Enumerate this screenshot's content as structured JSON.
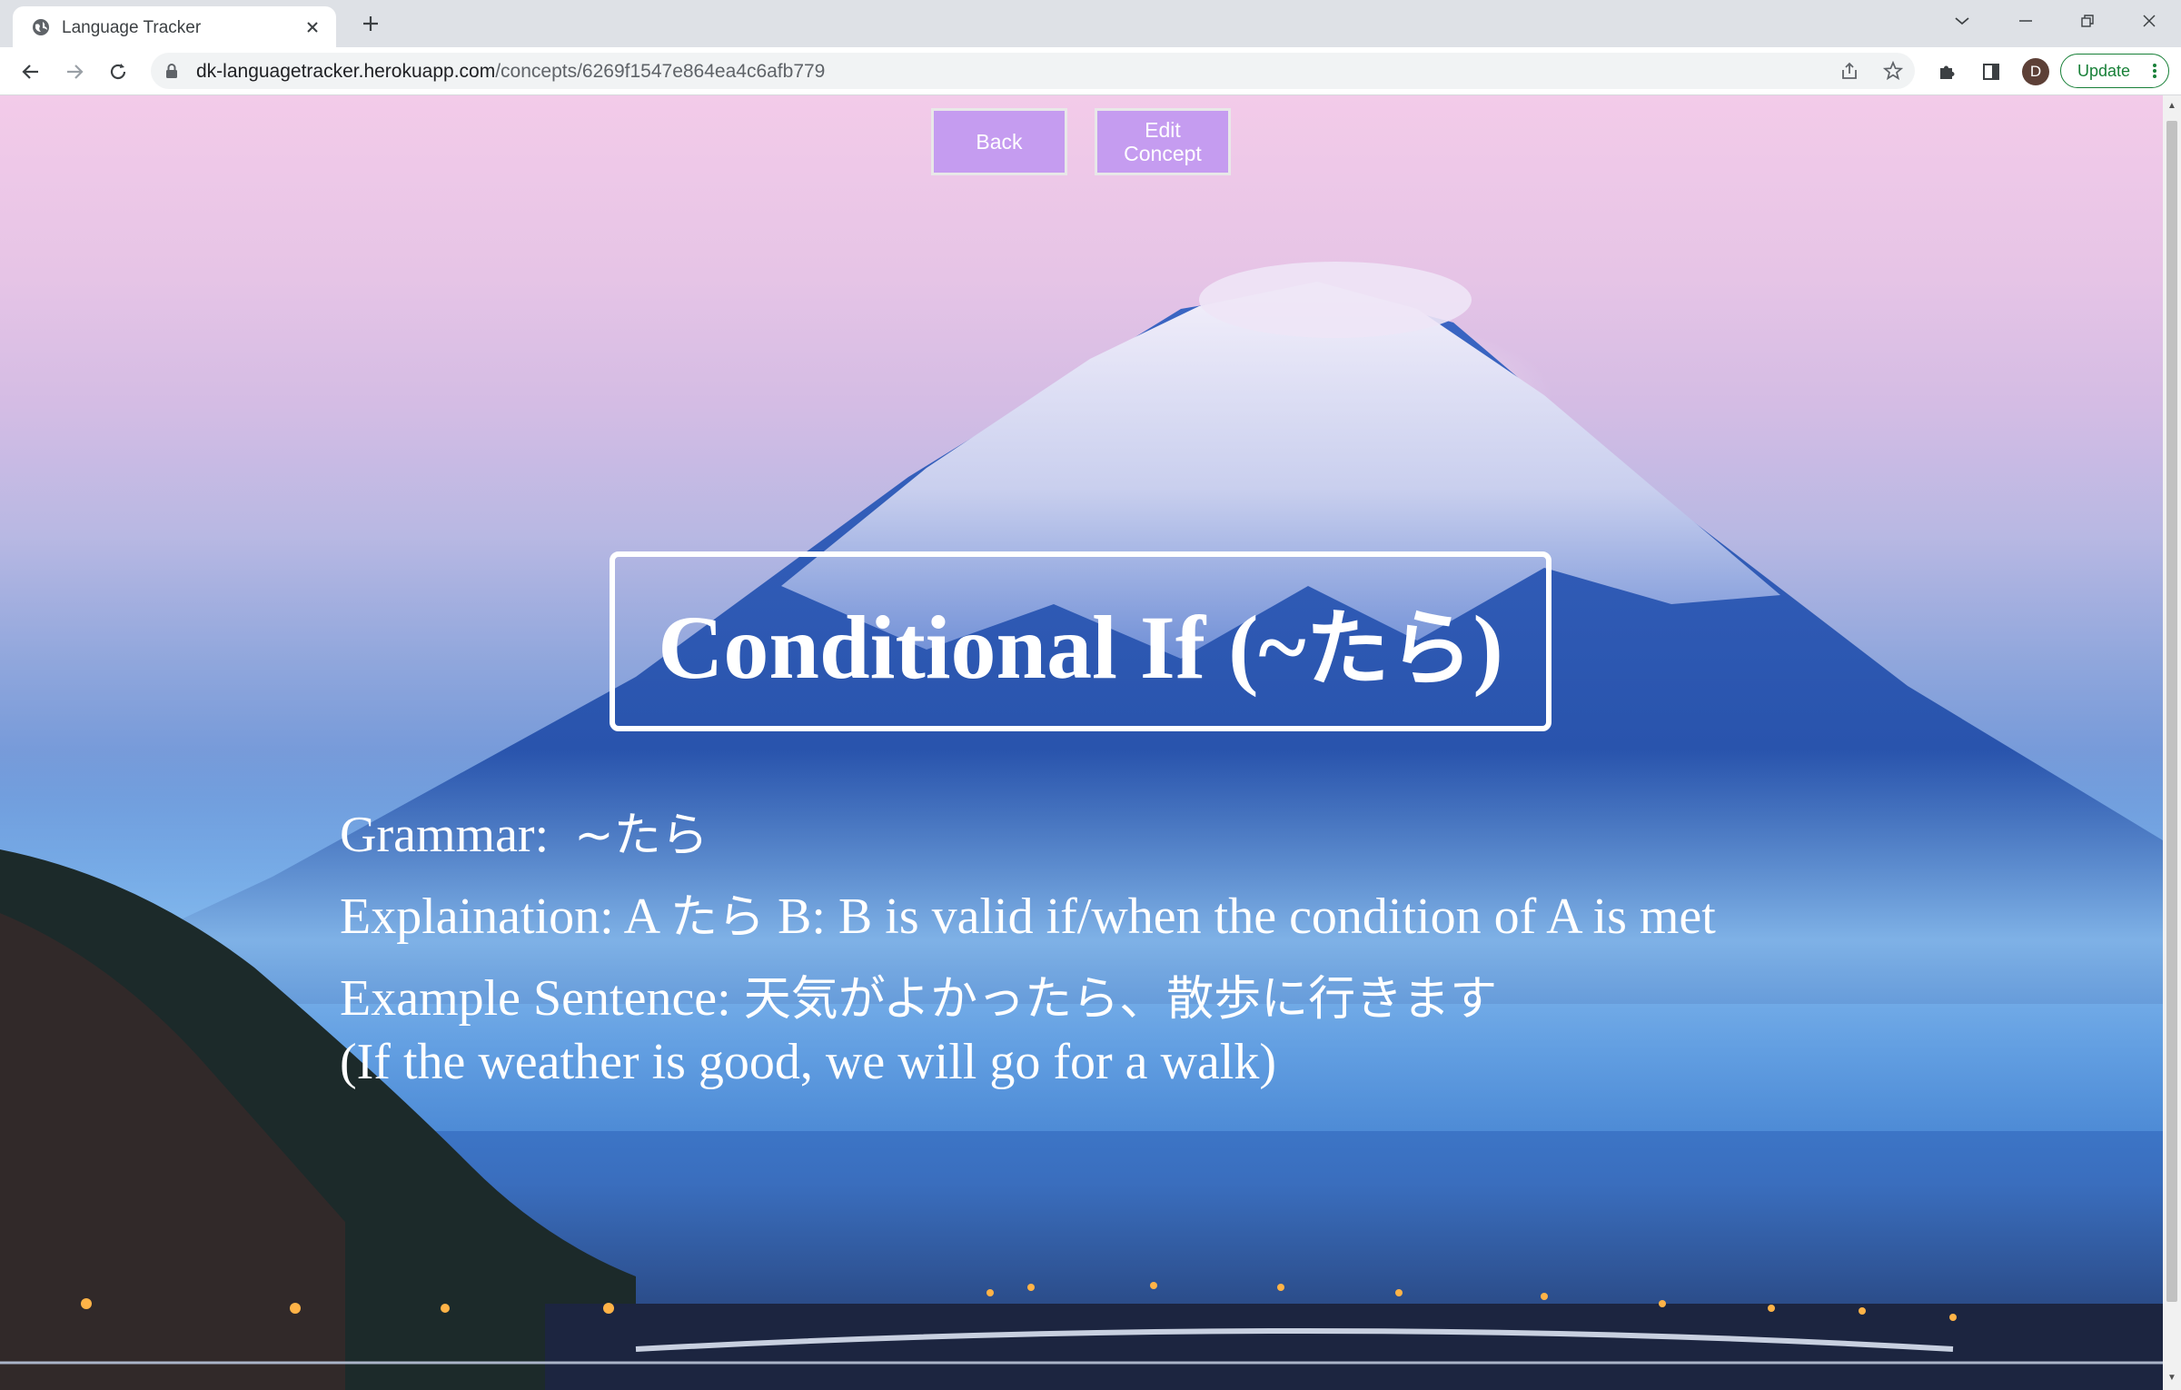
{
  "browser": {
    "tab_title": "Language Tracker",
    "url_domain": "dk-languagetracker.herokuapp.com",
    "url_path": "/concepts/6269f1547e864ea4c6afb779",
    "update_label": "Update",
    "avatar_letter": "D"
  },
  "page": {
    "back_label": "Back",
    "edit_label_line1": "Edit",
    "edit_label_line2": "Concept",
    "title_en": "Conditional If (~",
    "title_jp": "たら",
    "title_close": ")",
    "grammar_label": "Grammar:",
    "grammar_value": "~たら",
    "explanation_label": "Explaination: A ",
    "explanation_jp": "たら",
    "explanation_rest": " B: B is valid if/when the condition of A is met",
    "example_label": "Example Sentence: ",
    "example_jp": "天気がよかったら、散歩に行きます",
    "translation": "(If the weather is good, we will go for a walk)"
  },
  "colors": {
    "button_bg": "#c59cf0",
    "update_green": "#188038"
  }
}
